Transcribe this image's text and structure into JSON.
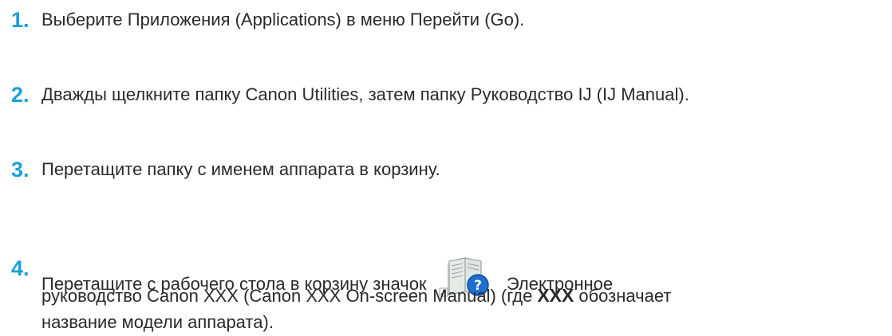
{
  "steps": [
    {
      "number": "1.",
      "text": "Выберите Приложения (Applications) в меню Перейти (Go)."
    },
    {
      "number": "2.",
      "text": "Дважды щелкните папку Canon Utilities, затем папку Руководство IJ (IJ Manual)."
    },
    {
      "number": "3.",
      "text": "Перетащите папку с именем аппарата в корзину."
    },
    {
      "number": "4.",
      "text_before_icon": "Перетащите с рабочего стола в корзину значок",
      "icon": "on-screen-manual-alias-icon",
      "text_after_icon": "Электронное",
      "line2_before_bold": "руководство Canon XXX (Canon XXX On-screen Manual) (где",
      "bold_text": "XXX",
      "line2_after_bold": "обозначает",
      "line3": "название модели аппарата)."
    }
  ]
}
